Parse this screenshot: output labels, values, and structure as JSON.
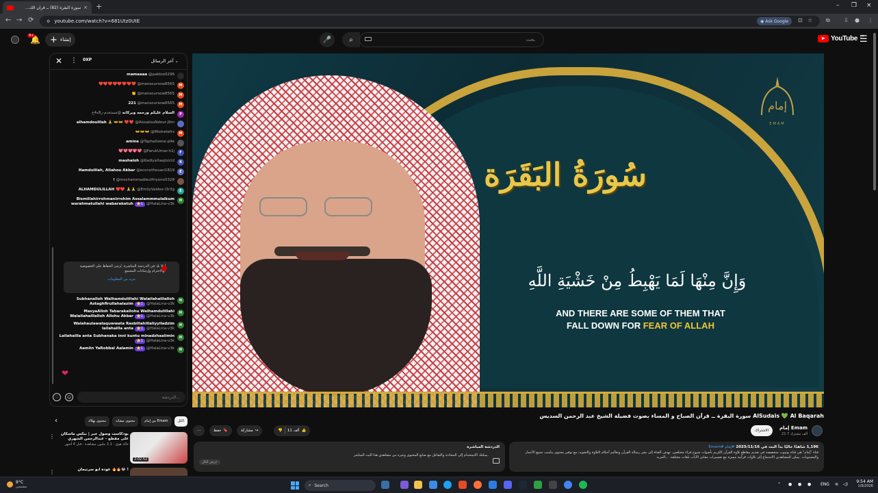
{
  "browser": {
    "tab_title": "سورة البقرة (82) ــ قرآن الك...",
    "tab_close": "×",
    "new_tab": "+",
    "window_controls": [
      "–",
      "❐",
      "×"
    ],
    "url": "youtube.com/watch?v=681Utz0UtE",
    "ask_google": "Ask Google",
    "nav": [
      "←",
      "→",
      "⟳"
    ]
  },
  "youtube": {
    "logo_word": "YouTube",
    "logo_sup": "17",
    "search_placeholder": "بحث",
    "create_label": "إنشاء",
    "notif_badge": "9+"
  },
  "chat": {
    "mode_label": "آخر الرسائل",
    "xp_label": "0XP",
    "input_placeholder": "الدردشة...",
    "messages": [
      {
        "author": "@pabloo0296",
        "text": "mamaaaa",
        "color": "#2a2a2a",
        "initial": ""
      },
      {
        "author": "@mansoursow8565",
        "text": "❤️❤️❤️❤️❤️❤️❤️❤️",
        "color": "#e64a19",
        "initial": "M"
      },
      {
        "author": "@mansoursow8565",
        "text": "👏",
        "color": "#e64a19",
        "initial": "M"
      },
      {
        "author": "@mansoursow8565",
        "text": "221",
        "color": "#e64a19",
        "initial": "M"
      },
      {
        "author": "@مستخدم-ر8ه4ع",
        "text": "السلام عليكم ورحمه وبركاته",
        "color": "#9c27b0",
        "initial": "P"
      },
      {
        "author": "@AissatouNdour-j9m",
        "text": "alhamdoulilah 🙏 👐👐 ❤️❤️",
        "color": "#5c6bc0",
        "initial": ""
      },
      {
        "author": "@Mistretefrs",
        "text": "👐👐👐",
        "color": "#e64a19",
        "initial": "M"
      },
      {
        "author": "@Taphalisene-p9e",
        "text": "amine",
        "color": "#555555",
        "initial": ""
      },
      {
        "author": "@FarukUmar-h1j",
        "text": "💖💖💖💖💖",
        "color": "#3f51b5",
        "initial": "F"
      },
      {
        "author": "@KadiyaXaajisicid",
        "text": "mashaloh",
        "color": "#3f51b5",
        "initial": "K"
      },
      {
        "author": "@econothouari1819",
        "text": "Hamdulilah, Allahou Akbar",
        "color": "#5c6bc0",
        "initial": "E"
      },
      {
        "author": "@mochammadleutfriyono5328",
        "text": "!",
        "color": "#795548",
        "initial": ""
      },
      {
        "author": "@EmilyValdez-i3r3g",
        "text": "ALHAMDULILLAH ❤️❤️ 🙏🙏",
        "color": "#26a69a",
        "initial": "E"
      },
      {
        "author": "@HalaLina-v3k",
        "text": "Bismillahirrohmanirrohim Assalammmulaikum warahmatullahi wabarakatuh",
        "color": "#2e7d32",
        "initial": "H",
        "sub": "⭐1"
      }
    ],
    "pinned_text": "أهلا بك في الدردشة المباشرة. يُرجى الحفاظ على الخصوصية والاحترام وإرشادات المجتمع.",
    "pinned_link": "مزيد من المعلومات",
    "messages2": [
      {
        "author": "@HalaLina-v3k",
        "text": "Subhanalloh Walhamdulillahi Walailahaillalloh Astaghfirullahalazim",
        "color": "#2e7d32",
        "initial": "H",
        "sub": "⭐1"
      },
      {
        "author": "@HalaLina-v3k",
        "text": "MasyaAlloh Tabarakallohu Walhamdulillahi Walailahaillalloh Allohu Akbar",
        "color": "#2e7d32",
        "initial": "H",
        "sub": "⭐1"
      },
      {
        "author": "@HalaLina-v3k",
        "text": "Walahaulawalaquwwata Rasbillahillaliyyiladzim lailahailla anta",
        "color": "#2e7d32",
        "initial": "H",
        "sub": "⭐1"
      },
      {
        "author": "@HalaLina-v3k",
        "text": "Lailahailla anta Subhanaka inni kuntu minadzhaalimin",
        "color": "#2e7d32",
        "initial": "H",
        "sub": "⭐1"
      },
      {
        "author": "@HalaLina-v3k",
        "text": "Aamiin YaRobbal Aalamin",
        "color": "#2e7d32",
        "initial": "H",
        "sub": "⭐1"
      }
    ]
  },
  "video": {
    "emblem_text": "إمام",
    "emblem_sub": "EMAM",
    "surah_title": "سُورَةُ البَقَرَة",
    "ayah_ar": "وَإِنَّ مِنْهَا لَمَا يَهْبِطُ مِنْ خَشْيَةِ اللَّهِ",
    "ayah_en_line1": "AND THERE ARE SOME OF THEM THAT",
    "ayah_en_line2_a": "FALL DOWN FOR",
    "ayah_en_line2_b": "FEAR OF ALLAH",
    "title": "سورة البقرة ــ قرآن الصباح و المساء بصوت فضيلة الشيخ عبد الرحمن السديس AlSudais 💚 Al Baqarah",
    "channel_name": "إمام Emam",
    "channel_subs": "21.7 ألف مشترك",
    "join_label": "الاشتراك",
    "like_count": "11 ألف",
    "share_label": "مشاركة",
    "save_label": "حفظ",
    "more_label": "···",
    "desc_stats": "1,196 شاهدًا حاليًا  بدأ البث في 2025/11/16",
    "desc_tags": "#إمام  #Emam",
    "desc_text": "قناة \"إمام\" هي قناة يوتيوب متخصصة في تقديم مقاطع تلاوة القرآن الكريم بأصوات شيوخ قراء مختلفين. تهدف القناة إلى نشر رسالة القرآن وتعاليم أحكام التلاوة والتجويد، مع توفير محتوى يناسب جميع الأعمار والمستويات. يمكن للمشاهدين الاستماع إلى تلاوات قرآنية مميزة مع تفسيرات معاني الآيات بلغات مختلفة. ...المزيد",
    "live_chat_heading": "الدردشة المباشرة",
    "live_chat_text": "يمكنك الاستخدام إلى المحادثة والتفاعل مع صانع المحتوى وغيره من مشاهدي هذا البث المباشر.",
    "live_chat_mini": "عرض الكل"
  },
  "recs": {
    "chips": [
      "الكل",
      "من إمام Emam",
      "محتوى مشابه",
      "محتوى بهلاك"
    ],
    "items": [
      {
        "title": "بودكاست وصول خبر | نيكس ماسكان على مقطع - عبدالرحمن الشهري",
        "meta": "خالد هوق · 2.1 مليون مشاهدة · قبل 4 أشهر",
        "duration": "2:02:52"
      },
      {
        "title": "عودة أبو سرتيمان 🔥🔥😂 !",
        "meta": "",
        "duration": ""
      }
    ]
  },
  "taskbar": {
    "temp": "9°C",
    "weather_desc": "مشمس",
    "search": "Search",
    "lang": "ENG",
    "time": "9:54 AM",
    "date": "1/9/2026"
  },
  "colors": {
    "accent_red": "#ff0000",
    "gold": "#d4aa3c",
    "teal": "#0e3740"
  }
}
